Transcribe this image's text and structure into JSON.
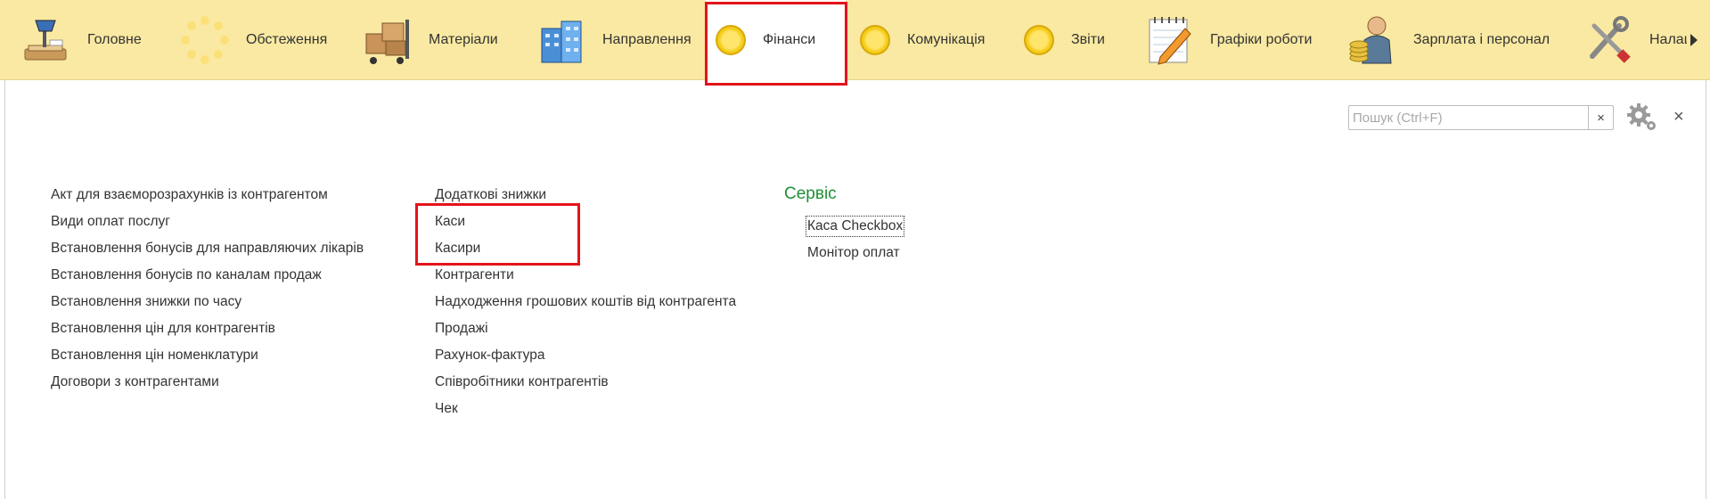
{
  "nav": {
    "items": [
      {
        "id": "home",
        "label": "Головне",
        "icon": "desk-lamp-icon"
      },
      {
        "id": "exams",
        "label": "Обстеження",
        "icon": "loading-ring-icon"
      },
      {
        "id": "materials",
        "label": "Матеріали",
        "icon": "boxes-cart-icon"
      },
      {
        "id": "referrals",
        "label": "Направлення",
        "icon": "building-icon"
      },
      {
        "id": "finance",
        "label": "Фінанси",
        "icon": "yellow-circle-icon"
      },
      {
        "id": "communication",
        "label": "Комунікація",
        "icon": "yellow-circle-icon"
      },
      {
        "id": "reports",
        "label": "Звіти",
        "icon": "yellow-circle-icon"
      },
      {
        "id": "schedules",
        "label": "Графіки роботи",
        "icon": "notepad-pencil-icon"
      },
      {
        "id": "salary",
        "label": "Зарплата і персонал",
        "icon": "worker-coins-icon"
      },
      {
        "id": "settings",
        "label": "Налаш",
        "icon": "tools-icon"
      }
    ],
    "active": "Фінанси"
  },
  "search": {
    "placeholder": "Пошук (Ctrl+F)",
    "clear": "×"
  },
  "close_label": "×",
  "columns": {
    "left": [
      "Акт для взаєморозрахунків із контрагентом",
      "Види оплат послуг",
      "Встановлення бонусів для направляючих лікарів",
      "Встановлення бонусів по каналам продаж",
      "Встановлення знижки по часу",
      "Встановлення цін для контрагентів",
      "Встановлення цін номенклатури",
      "Договори з контрагентами"
    ],
    "middle": [
      "Додаткові знижки",
      "Каси",
      "Касири",
      "Контрагенти",
      "Надходження грошових коштів від контрагента",
      "Продажі",
      "Рахунок-фактура",
      "Співробітники контрагентів",
      "Чек"
    ],
    "service": {
      "title": "Сервіс",
      "items": [
        "Каса Checkbox",
        "Монітор оплат"
      ]
    }
  },
  "colors": {
    "topbar": "#fae9a2",
    "highlight": "#e4141b",
    "section_title": "#1f8f35"
  }
}
